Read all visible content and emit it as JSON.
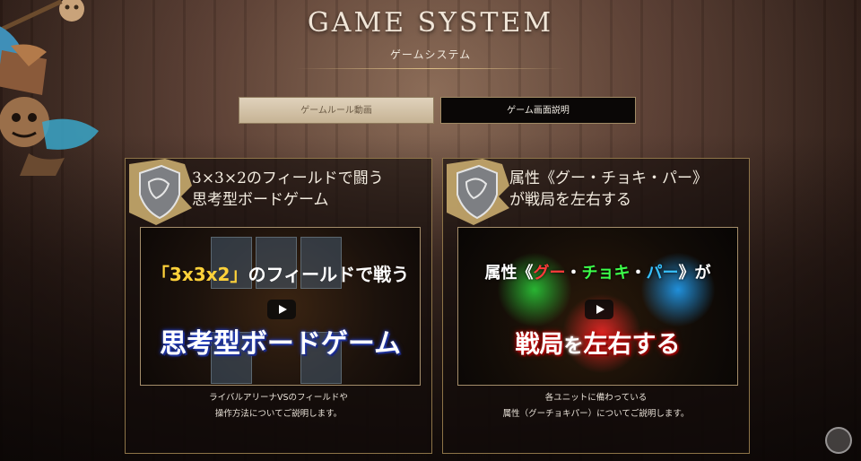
{
  "header": {
    "title": "GAME SYSTEM",
    "subtitle": "ゲームシステム"
  },
  "tabs": [
    {
      "label": "ゲームルール動画",
      "active": true
    },
    {
      "label": "ゲーム画面説明",
      "active": false
    }
  ],
  "cards": [
    {
      "title_lines": [
        "3×3×2のフィールドで闘う",
        "思考型ボードゲーム"
      ],
      "video": {
        "top_parts": [
          "「3x3x2」",
          "のフィールドで戦う"
        ],
        "bottom": "思考型ボードゲーム"
      },
      "desc_lines": [
        "ライバルアリーナVSのフィールドや",
        "操作方法についてご説明します。"
      ]
    },
    {
      "title_lines": [
        "属性《グー・チョキ・パー》",
        "が戦局を左右する"
      ],
      "video": {
        "top_parts": [
          "属性《",
          "グー",
          "・",
          "チョキ",
          "・",
          "パー",
          "》が"
        ],
        "bottom_parts": [
          "戦局",
          "を",
          "左右する"
        ]
      },
      "desc_lines": [
        "各ユニットに備わっている",
        "属性（グーチョキパー）についてご説明します。"
      ]
    }
  ],
  "colors": {
    "accent_gold": "#8d7448",
    "tab_active_bg": "#d6c6ab",
    "tab_inactive_bg": "#0a0706"
  }
}
